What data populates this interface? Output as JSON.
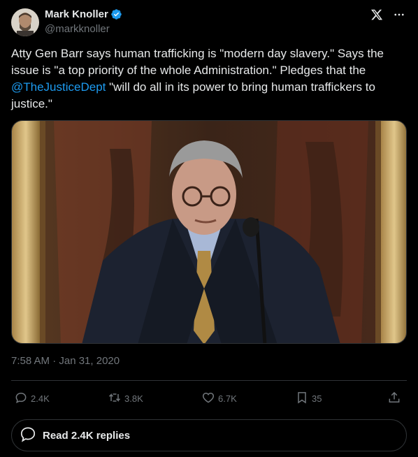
{
  "author": {
    "name": "Mark Knoller",
    "handle": "@markknoller",
    "verified": true
  },
  "tweet": {
    "text_part1": "Atty Gen Barr says human trafficking is \"modern day slavery.\" Says the issue is \"a top priority of the whole Administration.\" Pledges that the ",
    "mention": "@TheJusticeDept",
    "text_part2": " \"will do all in its power to bring human traffickers to justice.\""
  },
  "timestamp": "7:58 AM · Jan 31, 2020",
  "actions": {
    "replies": "2.4K",
    "reposts": "3.8K",
    "likes": "6.7K",
    "bookmarks": "35"
  },
  "read_replies_label": "Read 2.4K replies",
  "icons": {
    "verified": "verified-badge-icon",
    "brand": "x-logo-icon",
    "more": "more-icon",
    "reply": "reply-icon",
    "repost": "repost-icon",
    "like": "heart-icon",
    "bookmark": "bookmark-icon",
    "share": "share-icon"
  },
  "colors": {
    "background": "#000000",
    "text": "#e7e9ea",
    "secondary": "#71767b",
    "accent": "#1d9bf0",
    "border": "#2f3336"
  }
}
